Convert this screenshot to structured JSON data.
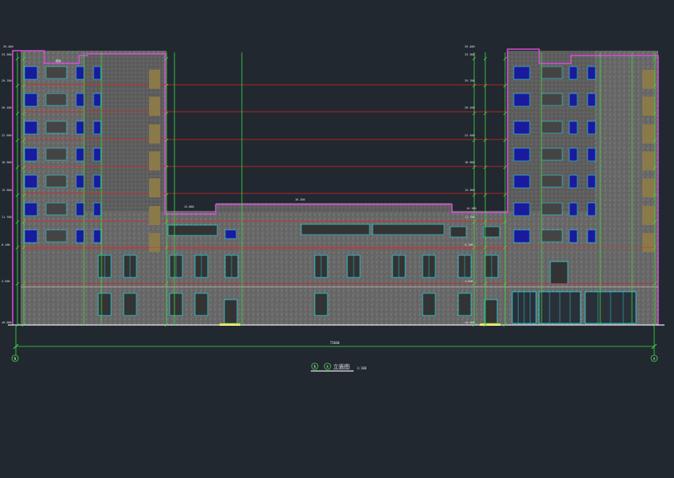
{
  "drawing": {
    "title": "立面图",
    "scale": "1:100",
    "axis_left": "N",
    "axis_right": "A",
    "overall_dimension": "75600",
    "parapet_label": "屋面",
    "center_roof_label": "16.200",
    "center_label_2": "14.100",
    "podium_label": "13.800",
    "left_top_label": "35.400",
    "right_top_label": "35.400",
    "floor_levels_left": [
      "33.300",
      "29.700",
      "26.100",
      "22.500",
      "18.900",
      "15.300",
      "11.700",
      "8.100",
      "4.500",
      "±0.000"
    ],
    "floor_levels_right": [
      "33.300",
      "29.700",
      "26.100",
      "22.500",
      "18.900",
      "15.300",
      "11.700",
      "8.100",
      "4.500",
      "±0.000"
    ]
  },
  "colors": {
    "background": "#212830",
    "facade": "#6b6b6b",
    "outline_magenta": "#d64fd6",
    "green": "#3fdc3f",
    "red": "#e32222",
    "cyan": "#27d4e0",
    "blue_window": "#1a1a9e",
    "olive": "#8a7a4a",
    "white": "#e8e8e8",
    "yellow": "#f0e000"
  }
}
